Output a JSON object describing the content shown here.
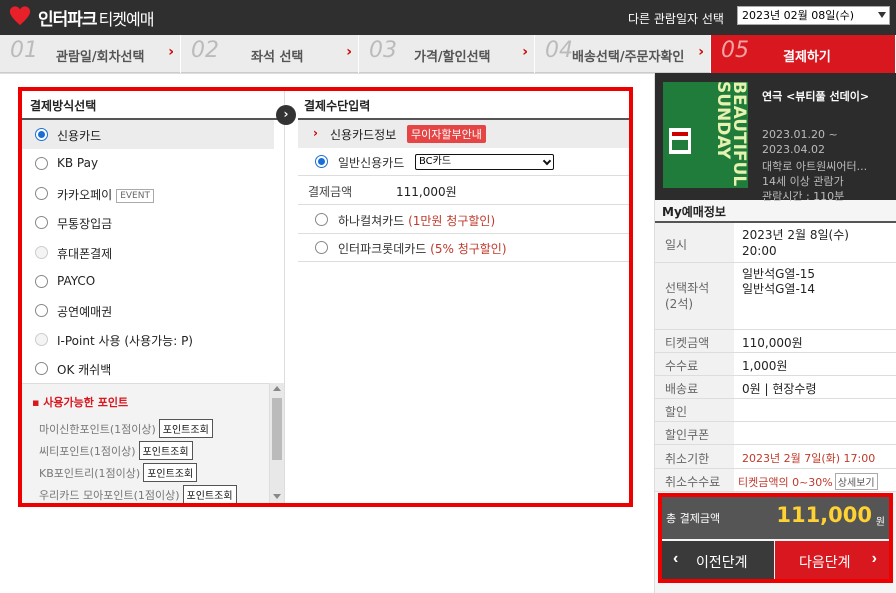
{
  "header": {
    "brand": "인터파크",
    "brand_sub": "티켓예매",
    "date_label": "다른 관람일자 선택",
    "date_value": "2023년 02월 08일(수)"
  },
  "steps": [
    {
      "num": "01",
      "label": "관람일/회차선택"
    },
    {
      "num": "02",
      "label": "좌석 선택"
    },
    {
      "num": "03",
      "label": "가격/할인선택"
    },
    {
      "num": "04",
      "label": "배송선택/주문자확인"
    },
    {
      "num": "05",
      "label": "결제하기"
    }
  ],
  "methods": {
    "title": "결제방식선택",
    "items": [
      {
        "label": "신용카드"
      },
      {
        "label": "KB Pay"
      },
      {
        "label": "카카오페이",
        "badge": "EVENT"
      },
      {
        "label": "무통장입금"
      },
      {
        "label": "휴대폰결제"
      },
      {
        "label": "PAYCO"
      },
      {
        "label": "공연예매권"
      },
      {
        "label": "I-Point 사용 (사용가능: P)"
      },
      {
        "label": "OK 캐쉬백"
      }
    ]
  },
  "points": {
    "title": "사용가능한 포인트",
    "button": "포인트조회",
    "items": [
      {
        "label": "마이신한포인트(1점이상)"
      },
      {
        "label": "씨티포인트(1점이상)"
      },
      {
        "label": "KB포인트리(1점이상)"
      },
      {
        "label": "우리카드 모아포인트(1점이상)"
      }
    ]
  },
  "payment": {
    "title": "결제수단입력",
    "cc_header": "신용카드정보",
    "cc_tag": "무이자할부안내",
    "general_card": "일반신용카드",
    "card_select": "BC카드",
    "amount_label": "결제금액",
    "amount_value": "111,000원",
    "hana": "하나컬쳐카드",
    "hana_discount": "(1만원 청구할인)",
    "lotte": "인터파크롯데카드",
    "lotte_discount": "(5% 청구할인)"
  },
  "show": {
    "title": "연극 <뷰티풀 선데이>",
    "poster_text": "BEAUTIFUL SUNDAY",
    "poster_sun": "SUN",
    "period_start": "2023.01.20 ~",
    "period_end": "2023.04.02",
    "venue": "대학로 아트원씨어터...",
    "age": "14세 이상 관람가",
    "runtime": "관람시간 : 110분"
  },
  "my": {
    "title": "My예매정보",
    "rows": [
      {
        "key": "일시",
        "value": "2023년 2월 8일(수)",
        "value2": "20:00"
      },
      {
        "key": "선택좌석",
        "key2": "(2석)",
        "value": "일반석G열-15",
        "value2": "일반석G열-14"
      },
      {
        "key": "티켓금액",
        "value": "110,000원"
      },
      {
        "key": "수수료",
        "value": "1,000원"
      },
      {
        "key": "배송료",
        "value": "0원 | 현장수령"
      },
      {
        "key": "할인",
        "value": ""
      },
      {
        "key": "할인쿠폰",
        "value": ""
      },
      {
        "key": "취소기한",
        "value": "2023년 2월 7일(화) 17:00"
      },
      {
        "key": "취소수수료",
        "value": "티켓금액의 0~30%",
        "button": "상세보기"
      }
    ]
  },
  "total": {
    "label": "총 결제금액",
    "value": "111,000",
    "unit": "원"
  },
  "buttons": {
    "prev": "이전단계",
    "next": "다음단계"
  },
  "colors": {
    "accent": "#d8171f",
    "header_bg": "#2f2f2f",
    "total_value": "#ffd233"
  }
}
